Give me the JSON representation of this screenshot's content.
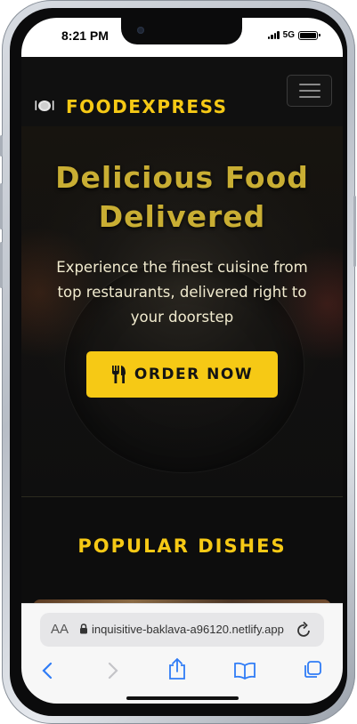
{
  "status_bar": {
    "time": "8:21 PM",
    "network": "5G"
  },
  "navbar": {
    "brand": "FOODEXPRESS",
    "brand_icon": "plate-utensils-icon",
    "menu_icon": "hamburger-menu-icon"
  },
  "hero": {
    "title_line1": "Delicious Food",
    "title_line2": "Delivered",
    "subtitle_line1": "Experience the finest cuisine from",
    "subtitle_line2": "top restaurants, delivered right to",
    "subtitle_line3": "your doorstep",
    "cta_label": "ORDER NOW",
    "cta_icon": "utensils-icon"
  },
  "popular": {
    "heading": "POPULAR DISHES"
  },
  "browser": {
    "text_size_label": "AA",
    "url": "inquisitive-baklava-a96120.netlify.app",
    "toolbar": [
      "back-icon",
      "forward-icon",
      "share-icon",
      "bookmarks-icon",
      "tabs-icon"
    ]
  },
  "colors": {
    "accent": "#f6c915",
    "background": "#0e0e0e",
    "browser_blue": "#2f7cf6"
  }
}
